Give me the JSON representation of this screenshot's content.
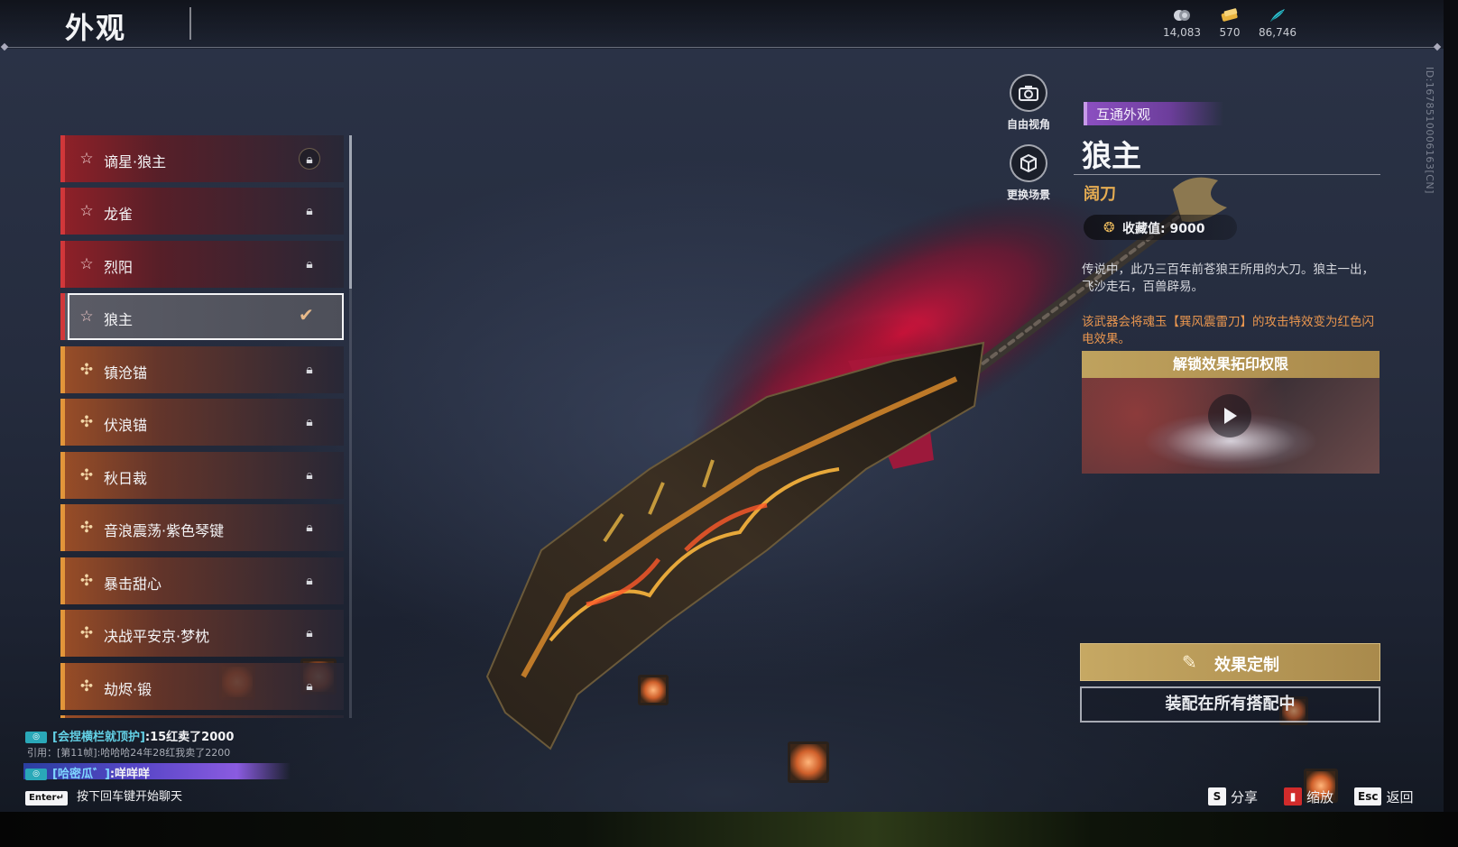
{
  "header": {
    "title": "外观",
    "currencies": [
      {
        "icon": "moon-coin-icon",
        "value": "14,083"
      },
      {
        "icon": "gold-ticket-icon",
        "value": "570"
      },
      {
        "icon": "cyan-feather-icon",
        "value": "86,746"
      }
    ]
  },
  "side_id": "ID:1678510006163[CN]",
  "tools": {
    "free_view": "自由视角",
    "change_scene": "更换场景"
  },
  "list": {
    "items": [
      {
        "name": "谪星·狼主",
        "rarity": "red",
        "state": "locked-ring"
      },
      {
        "name": "龙雀",
        "rarity": "red",
        "state": "locked"
      },
      {
        "name": "烈阳",
        "rarity": "red",
        "state": "locked"
      },
      {
        "name": "狼主",
        "rarity": "red",
        "state": "selected"
      },
      {
        "name": "镇沧锚",
        "rarity": "orange",
        "state": "locked"
      },
      {
        "name": "伏浪锚",
        "rarity": "orange",
        "state": "locked"
      },
      {
        "name": "秋日裁",
        "rarity": "orange",
        "state": "locked"
      },
      {
        "name": "音浪震荡·紫色琴键",
        "rarity": "orange",
        "state": "locked"
      },
      {
        "name": "暴击甜心",
        "rarity": "orange",
        "state": "locked"
      },
      {
        "name": "决战平安京·梦枕",
        "rarity": "orange",
        "state": "locked"
      },
      {
        "name": "劫烬·锻",
        "rarity": "orange",
        "state": "locked"
      }
    ]
  },
  "detail": {
    "tag": "互通外观",
    "title": "狼主",
    "type": "阔刀",
    "collect_label": "收藏值: 9000",
    "description": "传说中，此乃三百年前苍狼王所用的大刀。狼主一出，飞沙走石，百兽辟易。",
    "effect_note": "该武器会将魂玉【巽风震雷刀】的攻击特效变为红色闪电效果。",
    "unlock_title": "解锁效果拓印权限",
    "customize_label": "效果定制",
    "equip_label": "装配在所有搭配中"
  },
  "hints": {
    "share_key": "S",
    "share": "分享",
    "zoom": "缩放",
    "back_key": "Esc",
    "back": "返回"
  },
  "chat": {
    "line1_name": "[会捏横栏就顶护]",
    "line1_msg": ":15红卖了2000",
    "line1_quote": "引用：[第11帧]:哈哈哈24年28红我卖了2200",
    "line2_name": "[哈密瓜゛]",
    "line2_msg": ":咩咩咩",
    "enter_key": "Enter↵",
    "enter_hint": "按下回车键开始聊天"
  },
  "colors": {
    "red_rarity": "#d1373a",
    "orange_rarity": "#e2953a",
    "gold_button": "#c6a863",
    "tag_purple": "#8b4fc0",
    "weapon_type_gold": "#e6ad52"
  }
}
